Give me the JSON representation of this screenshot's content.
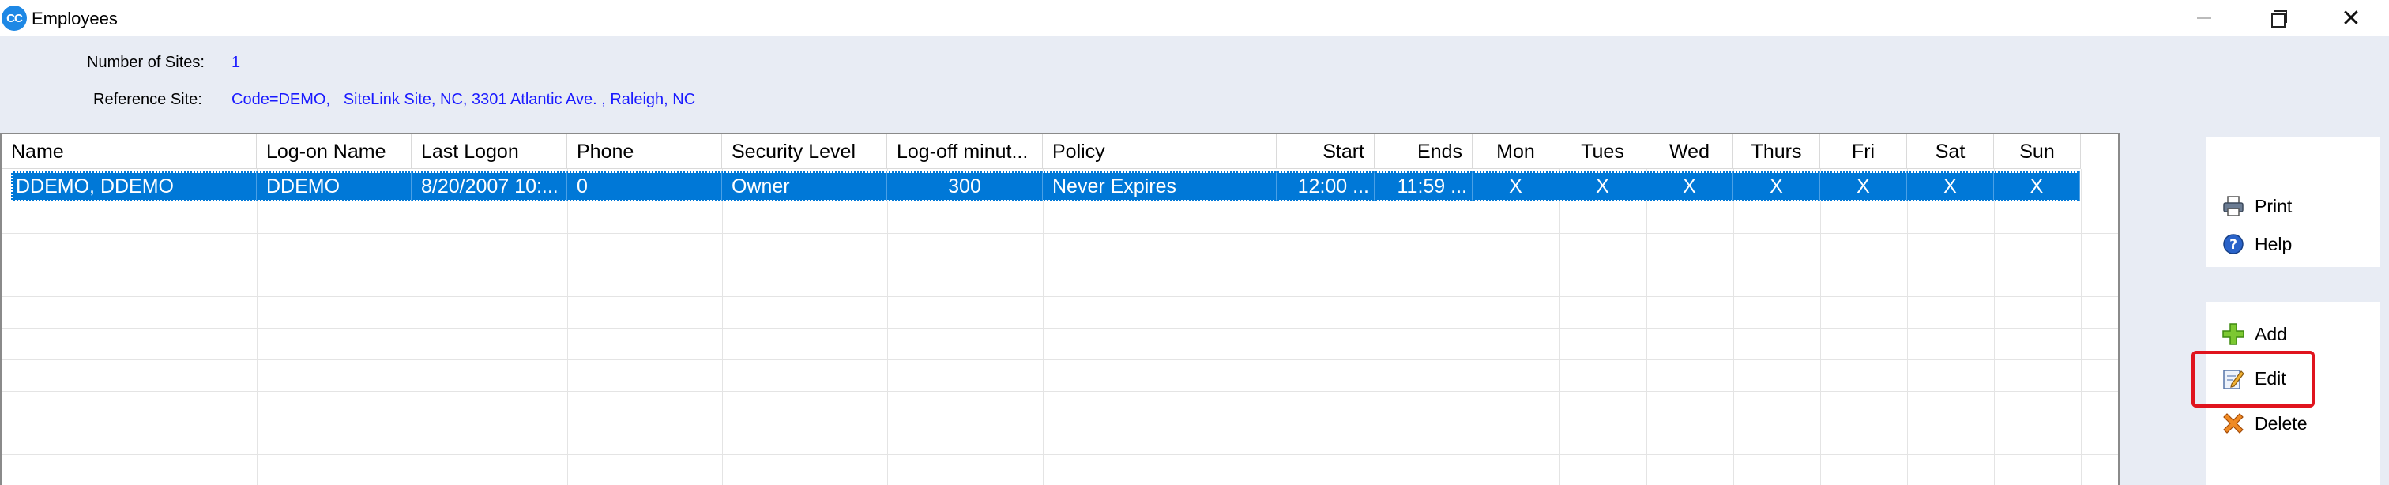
{
  "window": {
    "title": "Employees",
    "app_icon_text": "CC",
    "close_glyph": "✕"
  },
  "info": {
    "sites_label": "Number of Sites:",
    "sites_value": "1",
    "reference_label": "Reference Site:",
    "reference_value": "Code=DEMO,   SiteLink Site, NC, 3301 Atlantic Ave. , Raleigh, NC"
  },
  "table": {
    "columns": [
      "Name",
      "Log-on Name",
      "Last Logon",
      "Phone",
      "Security Level",
      "Log-off minut...",
      "Policy",
      "Start",
      "Ends",
      "Mon",
      "Tues",
      "Wed",
      "Thurs",
      "Fri",
      "Sat",
      "Sun"
    ],
    "rows": [
      [
        "DDEMO, DDEMO",
        "DDEMO",
        "8/20/2007 10:...",
        "0",
        "Owner",
        "300",
        "Never Expires",
        "12:00 ...",
        "11:59 ...",
        "X",
        "X",
        "X",
        "X",
        "X",
        "X",
        "X"
      ]
    ],
    "selected_row": 0
  },
  "actions": {
    "print": "Print",
    "help": "Help",
    "add": "Add",
    "edit": "Edit",
    "delete": "Delete"
  },
  "colors": {
    "selection": "#0078d7",
    "link_value": "#1a1aff",
    "highlight": "#e0141e",
    "background": "#e8ecf4"
  }
}
